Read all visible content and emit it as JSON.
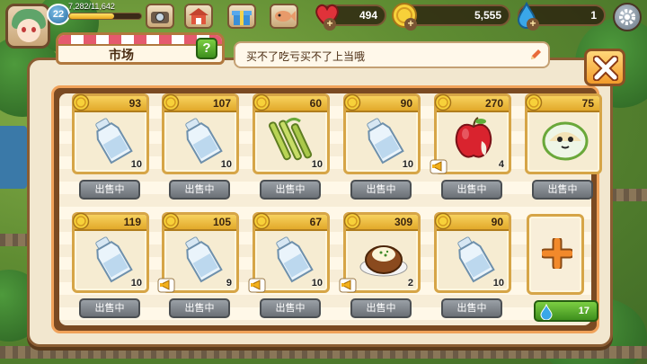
{
  "hud": {
    "level": "22",
    "xp_text": "7,282/11,642",
    "xp_progress": 0.625,
    "hearts": "494",
    "coins": "5,555",
    "gems": "1"
  },
  "market": {
    "title": "市场",
    "help": "?",
    "message": "买不了吃亏买不了上当哦",
    "slots": [
      {
        "price": "93",
        "item": "milk-bottle",
        "qty": "10",
        "status": "出售中",
        "ad": false
      },
      {
        "price": "107",
        "item": "milk-bottle",
        "qty": "10",
        "status": "出售中",
        "ad": false
      },
      {
        "price": "60",
        "item": "sugarcane",
        "qty": "10",
        "status": "出售中",
        "ad": false
      },
      {
        "price": "90",
        "item": "milk-bottle",
        "qty": "10",
        "status": "出售中",
        "ad": false
      },
      {
        "price": "270",
        "item": "apple",
        "qty": "4",
        "status": "出售中",
        "ad": true
      },
      {
        "price": "75",
        "item": "onigiri",
        "qty": "",
        "status": "出售中",
        "ad": false
      },
      {
        "price": "119",
        "item": "milk-bottle",
        "qty": "10",
        "status": "出售中",
        "ad": false
      },
      {
        "price": "105",
        "item": "milk-bottle",
        "qty": "9",
        "status": "出售中",
        "ad": true
      },
      {
        "price": "67",
        "item": "milk-bottle",
        "qty": "10",
        "status": "出售中",
        "ad": true
      },
      {
        "price": "309",
        "item": "baked-potato",
        "qty": "2",
        "status": "出售中",
        "ad": true
      },
      {
        "price": "90",
        "item": "milk-bottle",
        "qty": "10",
        "status": "出售中",
        "ad": false
      }
    ],
    "expand_cost": "17"
  },
  "colors": {
    "frame_orange": "#f0a25a",
    "price_gold": "#e2a92a",
    "sell_grey": "#6b7076",
    "accent_green": "#3e8f1d"
  }
}
